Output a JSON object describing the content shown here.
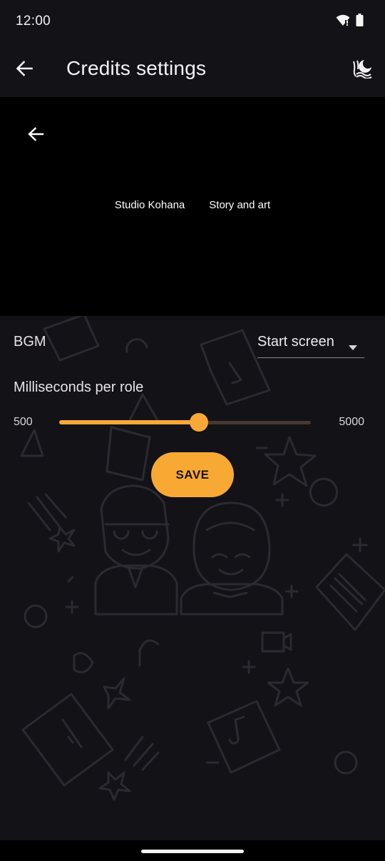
{
  "status_bar": {
    "time": "12:00"
  },
  "app_bar": {
    "title": "Credits settings"
  },
  "preview": {
    "credits": [
      "Studio Kohana",
      "Story and art"
    ]
  },
  "settings": {
    "bgm": {
      "label": "BGM",
      "value": "Start screen"
    },
    "duration": {
      "label": "Milliseconds per role",
      "min_label": "500",
      "max_label": "5000",
      "fraction": 0.556
    },
    "save_label": "SAVE"
  },
  "colors": {
    "accent": "#f7a837",
    "background": "#131217",
    "preview_background": "#000000",
    "doodle": "#2b2a31"
  }
}
